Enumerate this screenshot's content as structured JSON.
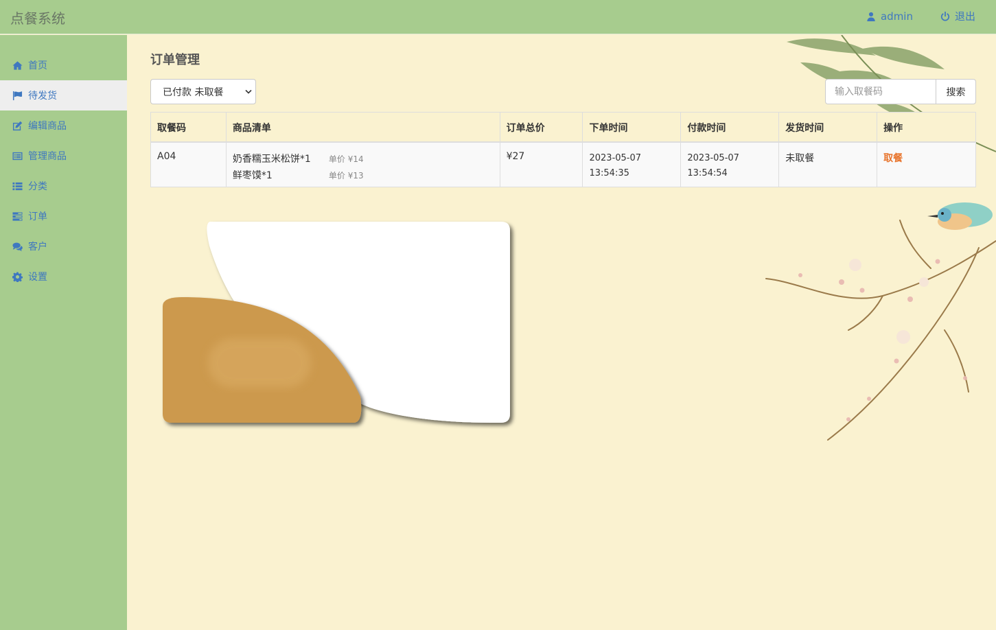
{
  "app": {
    "title": "点餐系统"
  },
  "topnav": {
    "user": "admin",
    "logout": "退出"
  },
  "sidebar": {
    "items": [
      {
        "label": "首页",
        "icon": "home-icon"
      },
      {
        "label": "待发货",
        "icon": "flag-icon",
        "active": true
      },
      {
        "label": "编辑商品",
        "icon": "edit-icon"
      },
      {
        "label": "管理商品",
        "icon": "list-alt-icon"
      },
      {
        "label": "分类",
        "icon": "list-icon"
      },
      {
        "label": "订单",
        "icon": "tasks-icon"
      },
      {
        "label": "客户",
        "icon": "comments-icon"
      },
      {
        "label": "设置",
        "icon": "gear-icon"
      }
    ]
  },
  "main": {
    "title": "订单管理",
    "filter": {
      "selected": "已付款 未取餐"
    },
    "search": {
      "placeholder": "输入取餐码",
      "button": "搜索"
    },
    "table": {
      "headers": [
        "取餐码",
        "商品清单",
        "订单总价",
        "下单时间",
        "付款时间",
        "发货时间",
        "操作"
      ],
      "rows": [
        {
          "code": "A04",
          "items": [
            {
              "name": "奶香糯玉米松饼*1",
              "price": "单价 ¥14"
            },
            {
              "name": "鲜枣馍*1",
              "price": "单价 ¥13"
            }
          ],
          "total": "¥27",
          "order_date": "2023-05-07",
          "order_time": "13:54:35",
          "pay_date": "2023-05-07",
          "pay_time": "13:54:54",
          "ship": "未取餐",
          "action": "取餐"
        }
      ]
    }
  },
  "colors": {
    "bar": "#a7cc8e",
    "background": "#faf2d0",
    "link": "#3f78c0",
    "action": "#e8742c"
  }
}
